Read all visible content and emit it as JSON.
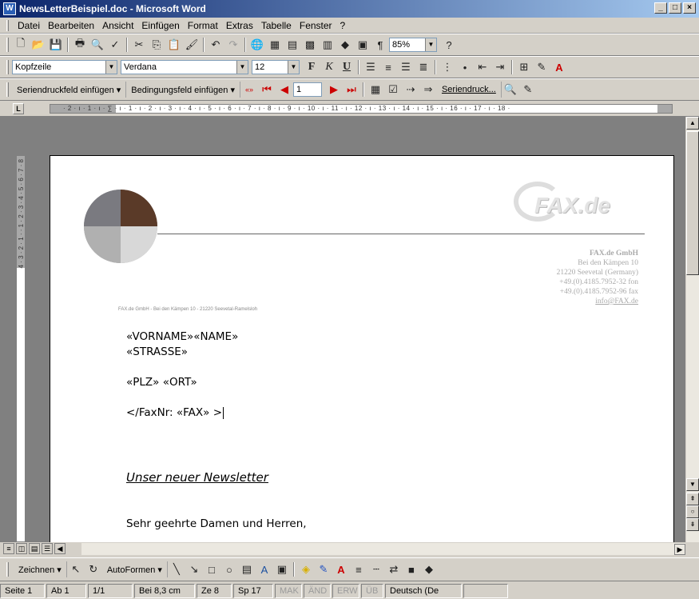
{
  "window": {
    "title": "NewsLetterBeispiel.doc - Microsoft Word",
    "app_icon": "W",
    "controls": [
      "_",
      "□",
      "×"
    ]
  },
  "menu": [
    "Datei",
    "Bearbeiten",
    "Ansicht",
    "Einfügen",
    "Format",
    "Extras",
    "Tabelle",
    "Fenster",
    "?"
  ],
  "toolbar_standard": {
    "zoom": "85%"
  },
  "toolbar_format": {
    "style": "Kopfzeile",
    "font": "Verdana",
    "size": "12",
    "bold": "F",
    "italic": "K",
    "underline": "U"
  },
  "toolbar_mailmerge": {
    "insert_mergefield": "Seriendruckfeld einfügen ▾",
    "insert_wordfield": "Bedingungsfeld einfügen ▾",
    "record": "1",
    "merge_to": "Seriendruck..."
  },
  "ruler": {
    "horizontal": "· 2 · ı · 1 · ı · ∑ · ı · 1 · ı · 2 · ı · 3 · ı · 4 · ı · 5 · ı · 6 · ı · 7 · ı · 8 · ı · 9 · ı · 10 · ı · 11 · ı · 12 · ı · 13 · ı · 14 · ı · 15 · ı · 16 · ı · 17 · ı · 18 ·",
    "vertical": "4 · 3 · 2 · 1 · · 1 · 2 · 3 · 4 · 5 · 6 · 7 · 8"
  },
  "document": {
    "logo_text": "FAX.de",
    "company": [
      "FAX.de GmbH",
      "Bei den Kämpen 10",
      "21220 Seevetal (Germany)",
      "+49.(0).4185.7952-32 fon",
      "+49.(0).4185.7952-96 fax",
      "info@FAX.de"
    ],
    "sender_line": "FAX.de GmbH - Bei den Kämpen 10 - 21220 Seevetal-Ramelsloh",
    "name_field": "«VORNAME»«NAME»",
    "street_field": "«STRASSE»",
    "city_field": "«PLZ» «ORT»",
    "fax_field": "</FaxNr: «FAX» >",
    "subject": "Unser neuer Newsletter",
    "salutation": "Sehr geehrte Damen und Herren,"
  },
  "drawing_toolbar": {
    "draw": "Zeichnen ▾",
    "autoshapes": "AutoFormen ▾"
  },
  "status": {
    "page": "Seite 1",
    "section": "Ab 1",
    "pages": "1/1",
    "position": "Bei 8,3 cm",
    "line": "Ze 8",
    "column": "Sp 17",
    "mak": "MAK",
    "and": "ÄND",
    "erw": "ERW",
    "ub": "ÜB",
    "language": "Deutsch (De"
  }
}
